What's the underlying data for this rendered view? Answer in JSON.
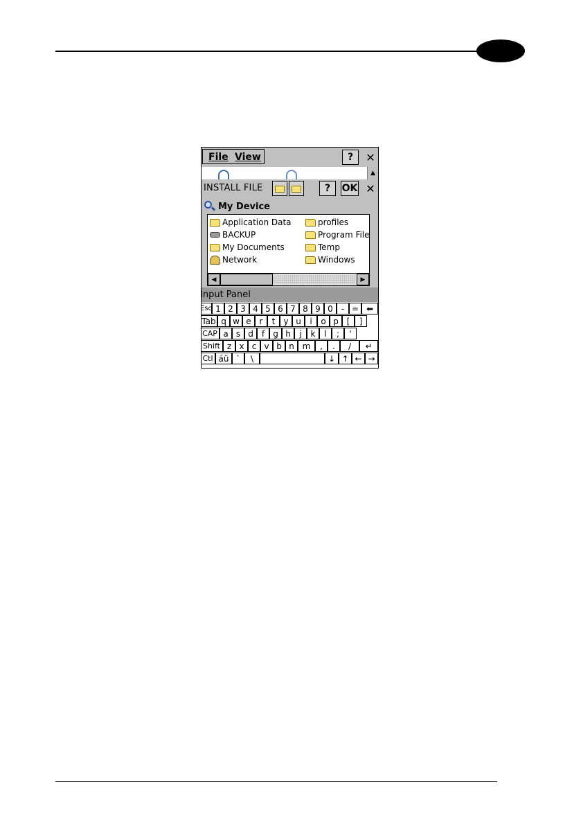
{
  "screen": {
    "menu": {
      "file": "File",
      "view": "View",
      "help": "?",
      "close": "✕"
    },
    "dialog": {
      "title": "INSTALL FILE",
      "help": "?",
      "ok": "OK",
      "close": "✕",
      "location": "My Device",
      "files": [
        {
          "name": "Application Data",
          "icon": "folder-icon"
        },
        {
          "name": "BACKUP",
          "icon": "drive-icon"
        },
        {
          "name": "My Documents",
          "icon": "folder-icon"
        },
        {
          "name": "Network",
          "icon": "network-icon"
        },
        {
          "name": "profiles",
          "icon": "folder-icon"
        },
        {
          "name": "Program Files",
          "icon": "folder-icon"
        },
        {
          "name": "Temp",
          "icon": "folder-icon"
        },
        {
          "name": "Windows",
          "icon": "folder-icon"
        }
      ]
    },
    "input_panel": {
      "label": "Input Panel"
    },
    "keyboard": {
      "row1": [
        "Esc",
        "1",
        "2",
        "3",
        "4",
        "5",
        "6",
        "7",
        "8",
        "9",
        "0",
        "-",
        "=",
        "⬅"
      ],
      "row2": [
        "Tab",
        "q",
        "w",
        "e",
        "r",
        "t",
        "y",
        "u",
        "i",
        "o",
        "p",
        "[",
        "]"
      ],
      "row3": [
        "CAP",
        "a",
        "s",
        "d",
        "f",
        "g",
        "h",
        "j",
        "k",
        "l",
        ";",
        "'"
      ],
      "row4": [
        "Shift",
        "z",
        "x",
        "c",
        "v",
        "b",
        "n",
        "m",
        ",",
        ".",
        "/",
        "↵"
      ],
      "row5": [
        "Ctl",
        "áü",
        "`",
        "\\",
        "",
        "↓",
        "↑",
        "←",
        "→"
      ]
    }
  }
}
